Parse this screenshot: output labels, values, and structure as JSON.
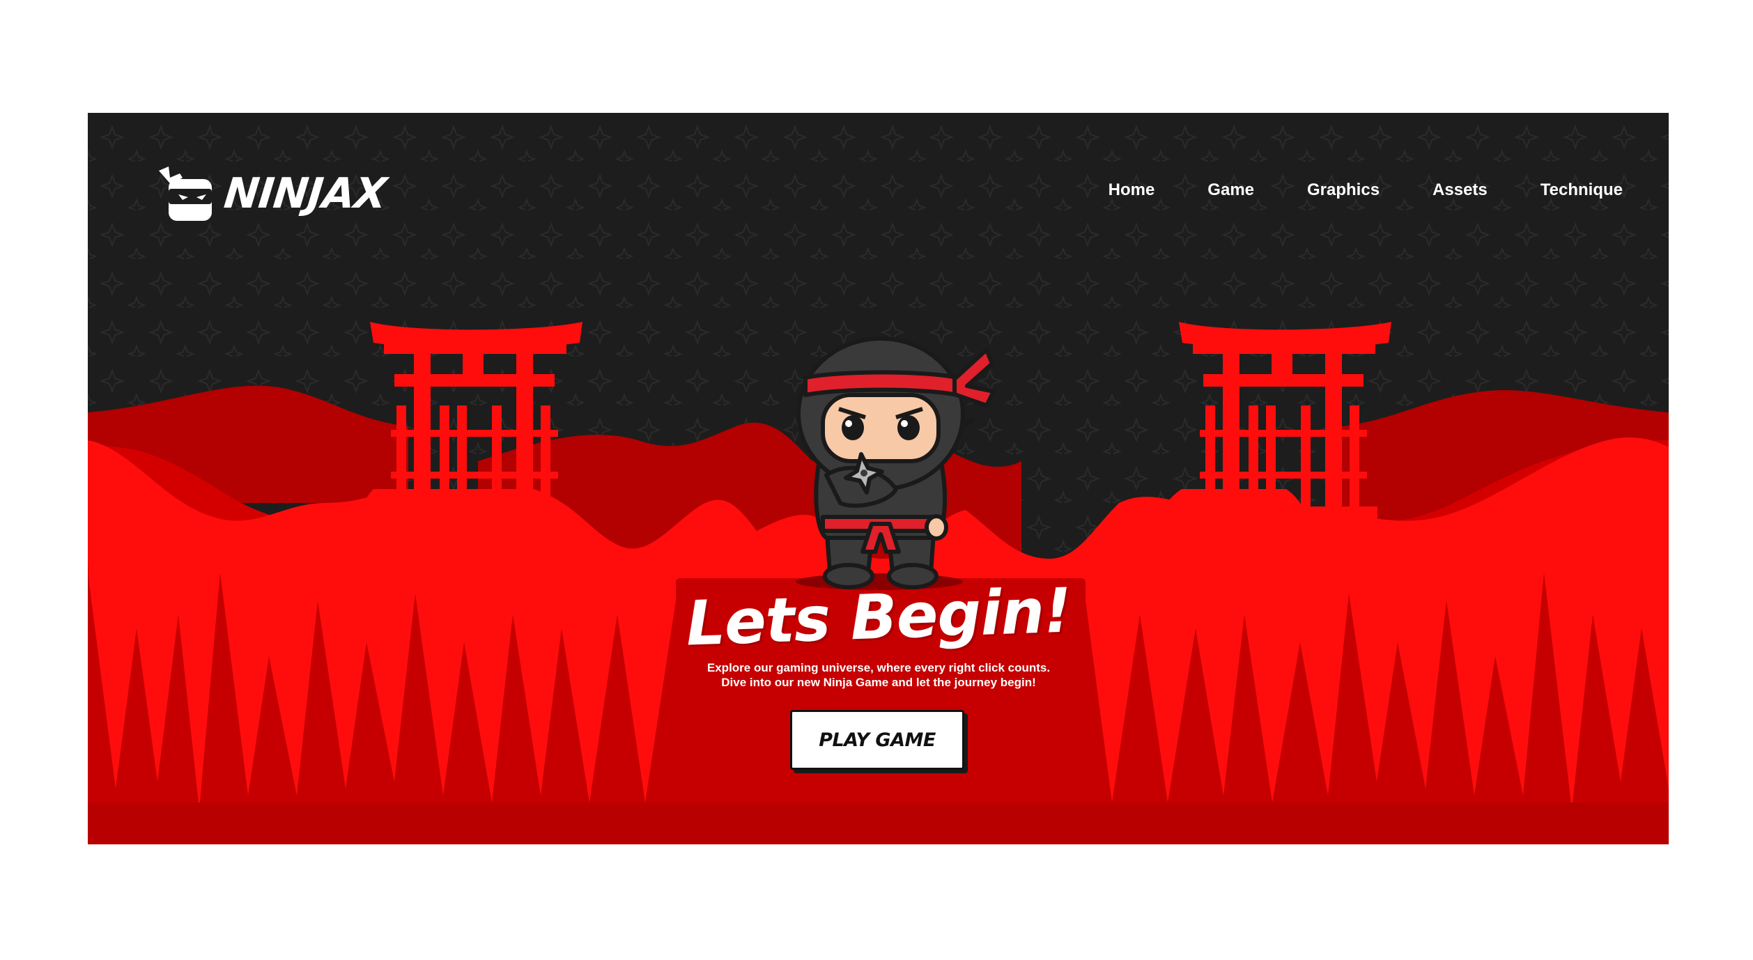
{
  "brand": {
    "name": "NINJAX",
    "logo_icon": "ninja-mask-icon"
  },
  "nav": {
    "items": [
      {
        "label": "Home"
      },
      {
        "label": "Game"
      },
      {
        "label": "Graphics"
      },
      {
        "label": "Assets"
      },
      {
        "label": "Technique"
      }
    ]
  },
  "hero": {
    "title": "Lets Begin!",
    "subtitle_line1": "Explore our gaming universe, where every right click counts.",
    "subtitle_line2": "Dive into our new Ninja Game and let the journey begin!",
    "button_label": "PLAY GAME"
  },
  "illustration": {
    "character": "ninja-character",
    "left_landmark": "torii-gate",
    "right_landmark": "torii-gate",
    "pattern_icon": "shuriken-icon"
  },
  "colors": {
    "background_dark": "#1d1d1d",
    "red_bright": "#ff0d0d",
    "red_mid": "#d40000",
    "red_dark": "#b30000",
    "white": "#ffffff"
  }
}
